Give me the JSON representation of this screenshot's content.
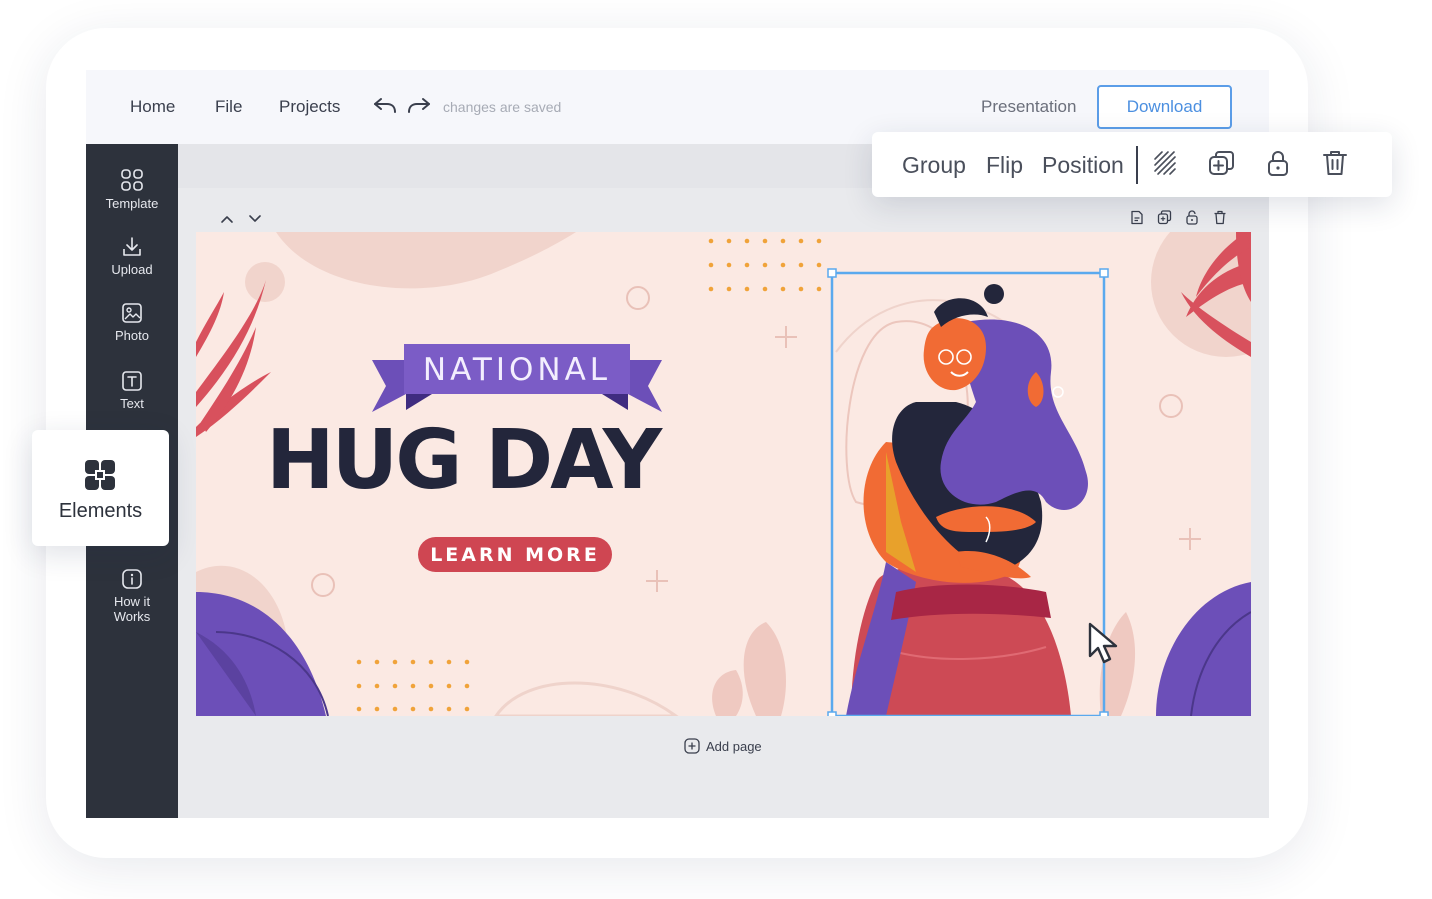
{
  "topbar": {
    "nav": [
      "Home",
      "File",
      "Projects"
    ],
    "status": "changes are saved",
    "presentation_label": "Presentation",
    "download_label": "Download",
    "icons": [
      "undo-icon",
      "redo-icon"
    ]
  },
  "sidebar": {
    "items": [
      {
        "label": "Template",
        "icon": "template-grid-icon"
      },
      {
        "label": "Upload",
        "icon": "upload-icon"
      },
      {
        "label": "Photo",
        "icon": "photo-icon"
      },
      {
        "label": "Text",
        "icon": "text-icon"
      },
      {
        "label": "Elements",
        "icon": "elements-icon"
      },
      {
        "label": "How it\nWorks",
        "icon": "info-icon"
      }
    ]
  },
  "floating_toolbar": {
    "group_label": "Group",
    "flip_label": "Flip",
    "position_label": "Position",
    "icons": [
      "transparency-icon",
      "duplicate-icon",
      "lock-icon",
      "trash-icon"
    ]
  },
  "canvas": {
    "page_controls": [
      "chevron-up-icon",
      "chevron-down-icon"
    ],
    "page_icons": [
      "note-icon",
      "duplicate-icon",
      "lock-icon",
      "trash-icon"
    ],
    "add_page_label": "Add page"
  },
  "design": {
    "ribbon_text": "NATIONAL",
    "title": "HUG DAY",
    "button_text": "LEARN MORE"
  },
  "colors": {
    "sidebar_bg": "#2d323c",
    "accent_blue": "#4b8fe0",
    "selection": "#5aa9ee",
    "design_bg": "#fbe9e3",
    "purple": "#6c4fb8",
    "red": "#cf4652",
    "navy": "#23263b",
    "orange": "#e8a12b"
  }
}
